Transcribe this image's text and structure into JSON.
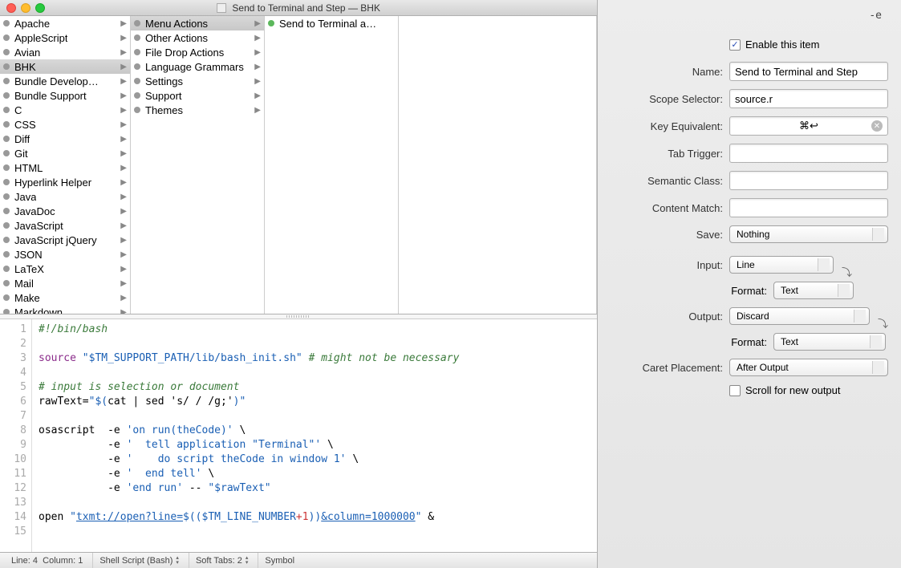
{
  "window": {
    "title": "Send to Terminal and Step — BHK"
  },
  "browser": {
    "col1": [
      {
        "label": "Apache",
        "arrow": true
      },
      {
        "label": "AppleScript",
        "arrow": true
      },
      {
        "label": "Avian",
        "arrow": true
      },
      {
        "label": "BHK",
        "arrow": true,
        "selected": true
      },
      {
        "label": "Bundle Develop…",
        "arrow": true
      },
      {
        "label": "Bundle Support",
        "arrow": true
      },
      {
        "label": "C",
        "arrow": true
      },
      {
        "label": "CSS",
        "arrow": true
      },
      {
        "label": "Diff",
        "arrow": true
      },
      {
        "label": "Git",
        "arrow": true
      },
      {
        "label": "HTML",
        "arrow": true
      },
      {
        "label": "Hyperlink Helper",
        "arrow": true
      },
      {
        "label": "Java",
        "arrow": true
      },
      {
        "label": "JavaDoc",
        "arrow": true
      },
      {
        "label": "JavaScript",
        "arrow": true
      },
      {
        "label": "JavaScript jQuery",
        "arrow": true
      },
      {
        "label": "JSON",
        "arrow": true
      },
      {
        "label": "LaTeX",
        "arrow": true
      },
      {
        "label": "Mail",
        "arrow": true
      },
      {
        "label": "Make",
        "arrow": true
      },
      {
        "label": "Markdown",
        "arrow": true
      }
    ],
    "col2": [
      {
        "label": "Menu Actions",
        "arrow": true,
        "selected": true
      },
      {
        "label": "Other Actions",
        "arrow": true
      },
      {
        "label": "File Drop Actions",
        "arrow": true
      },
      {
        "label": "Language Grammars",
        "arrow": true
      },
      {
        "label": "Settings",
        "arrow": true
      },
      {
        "label": "Support",
        "arrow": true
      },
      {
        "label": "Themes",
        "arrow": true
      }
    ],
    "col3": [
      {
        "label": "Send to Terminal a…",
        "cmd": true
      }
    ]
  },
  "code": {
    "lines": [
      {
        "n": 1,
        "segments": [
          {
            "t": "#!/bin/bash",
            "c": "c-comment"
          }
        ]
      },
      {
        "n": 2,
        "segments": []
      },
      {
        "n": 3,
        "segments": [
          {
            "t": "source ",
            "c": "c-key"
          },
          {
            "t": "\"",
            "c": "c-str"
          },
          {
            "t": "$TM_SUPPORT_PATH",
            "c": "c-var"
          },
          {
            "t": "/lib/bash_init.sh\"",
            "c": "c-str"
          },
          {
            "t": " # might not be necessary",
            "c": "c-comment"
          }
        ]
      },
      {
        "n": 4,
        "segments": []
      },
      {
        "n": 5,
        "segments": [
          {
            "t": "# input is selection or document",
            "c": "c-comment"
          }
        ]
      },
      {
        "n": 6,
        "segments": [
          {
            "t": "rawText="
          },
          {
            "t": "\"$(",
            "c": "c-str"
          },
          {
            "t": "cat | sed 's/ / /g;'"
          },
          {
            "t": ")\"",
            "c": "c-str"
          }
        ]
      },
      {
        "n": 7,
        "segments": []
      },
      {
        "n": 8,
        "segments": [
          {
            "t": "osascript  -e "
          },
          {
            "t": "'on run(theCode)'",
            "c": "c-str"
          },
          {
            "t": " \\"
          }
        ]
      },
      {
        "n": 9,
        "segments": [
          {
            "t": "           -e "
          },
          {
            "t": "'  tell application \"Terminal\"'",
            "c": "c-str"
          },
          {
            "t": " \\"
          }
        ]
      },
      {
        "n": 10,
        "segments": [
          {
            "t": "           -e "
          },
          {
            "t": "'    do script theCode in window 1'",
            "c": "c-str"
          },
          {
            "t": " \\"
          }
        ]
      },
      {
        "n": 11,
        "segments": [
          {
            "t": "           -e "
          },
          {
            "t": "'  end tell'",
            "c": "c-str"
          },
          {
            "t": " \\"
          }
        ]
      },
      {
        "n": 12,
        "segments": [
          {
            "t": "           -e "
          },
          {
            "t": "'end run'",
            "c": "c-str"
          },
          {
            "t": " -- "
          },
          {
            "t": "\"",
            "c": "c-str"
          },
          {
            "t": "$rawText",
            "c": "c-var"
          },
          {
            "t": "\"",
            "c": "c-str"
          }
        ]
      },
      {
        "n": 13,
        "segments": []
      },
      {
        "n": 14,
        "segments": [
          {
            "t": "open "
          },
          {
            "t": "\"",
            "c": "c-str"
          },
          {
            "t": "txmt://open?line=",
            "c": "c-link"
          },
          {
            "t": "$((",
            "c": "c-str"
          },
          {
            "t": "$TM_LINE_NUMBER",
            "c": "c-var"
          },
          {
            "t": "+1",
            "c": "c-op"
          },
          {
            "t": "))",
            "c": "c-str"
          },
          {
            "t": "&column=1000000",
            "c": "c-link"
          },
          {
            "t": "\"",
            "c": "c-str"
          },
          {
            "t": " &"
          }
        ]
      },
      {
        "n": 15,
        "segments": []
      }
    ]
  },
  "status": {
    "line_label": "Line:",
    "line": 4,
    "col_label": "Column:",
    "col": 1,
    "grammar": "Shell Script (Bash)",
    "tabs_label": "Soft Tabs:",
    "tabs": 2,
    "symbol": "Symbol"
  },
  "inspector": {
    "header": "-e",
    "enable_label": "Enable this item",
    "enable_checked": true,
    "name_label": "Name:",
    "name_value": "Send to Terminal and Step",
    "scope_label": "Scope Selector:",
    "scope_value": "source.r",
    "key_label": "Key Equivalent:",
    "key_value": "⌘↩",
    "tab_label": "Tab Trigger:",
    "tab_value": "",
    "semantic_label": "Semantic Class:",
    "semantic_value": "",
    "content_label": "Content Match:",
    "content_value": "",
    "save_label": "Save:",
    "save_value": "Nothing",
    "input_label": "Input:",
    "input_value": "Line",
    "input_format_label": "Format:",
    "input_format_value": "Text",
    "output_label": "Output:",
    "output_value": "Discard",
    "output_format_label": "Format:",
    "output_format_value": "Text",
    "caret_label": "Caret Placement:",
    "caret_value": "After Output",
    "scroll_label": "Scroll for new output",
    "scroll_checked": false
  }
}
